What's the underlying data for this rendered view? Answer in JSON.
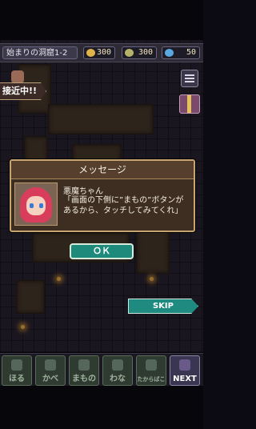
{
  "top_bar": {
    "stage_label": "始まりの洞窟1-2",
    "resources": [
      {
        "icon": "coin-icon",
        "color": "#e0b24a",
        "value": "300"
      },
      {
        "icon": "leaf-icon",
        "color": "#b5b36a",
        "value": "300"
      },
      {
        "icon": "gem-icon",
        "color": "#5aa8e0",
        "value": "50"
      }
    ]
  },
  "banner": {
    "approaching_label": "接近中!!"
  },
  "dialog": {
    "title": "メッセージ",
    "speaker": "悪魔ちゃん",
    "message": "「画面の下側に”まもの”ボタンがあるから、タッチしてみてくれ」",
    "ok_label": "ＯＫ"
  },
  "skip_label": "SKIP",
  "bottom_buttons": [
    {
      "label": "ほる"
    },
    {
      "label": "かべ"
    },
    {
      "label": "まもの"
    },
    {
      "label": "わな"
    },
    {
      "label": "たからばこ"
    },
    {
      "label": "NEXT"
    }
  ]
}
